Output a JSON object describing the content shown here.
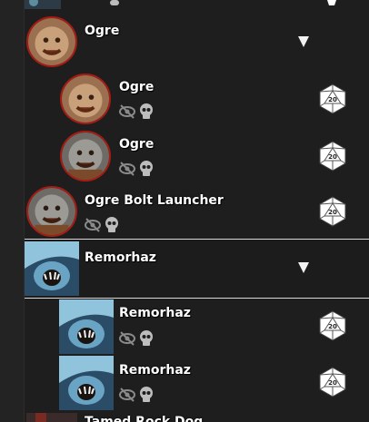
{
  "groups": [
    {
      "name": "Ogre",
      "children": [
        {
          "name": "Ogre"
        },
        {
          "name": "Ogre"
        }
      ]
    },
    {
      "name": "Ogre Bolt Launcher"
    },
    {
      "name": "Remorhaz",
      "children": [
        {
          "name": "Remorhaz"
        },
        {
          "name": "Remorhaz"
        }
      ]
    },
    {
      "name": "Tamed Rock Dog"
    }
  ],
  "icons": {
    "hidden": "eye-slash-icon",
    "defeated": "skull-icon",
    "initiative": "d20-icon",
    "expand": "caret-down-icon"
  },
  "colors": {
    "background": "#1e1e1e",
    "portrait_border": "#a51c14",
    "selected_border": "#d8d8d8"
  }
}
